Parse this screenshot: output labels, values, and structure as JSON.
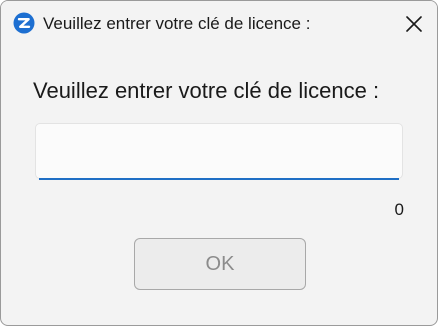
{
  "window": {
    "title": "Veuillez entrer votre clé de licence :",
    "app_icon": "app-logo-icon",
    "close_icon": "close-icon"
  },
  "dialog": {
    "prompt": "Veuillez entrer votre clé de licence :",
    "license_input": {
      "value": "",
      "placeholder": ""
    },
    "char_count": "0",
    "ok_label": "OK"
  },
  "colors": {
    "accent": "#1f6fc5",
    "background": "#f3f3f3",
    "button_text_disabled": "#8c8c8c"
  }
}
